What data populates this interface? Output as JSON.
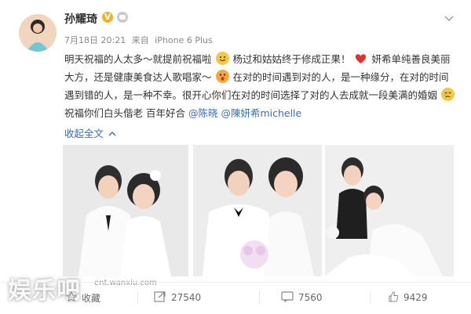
{
  "user": {
    "name": "孙耀琦",
    "verified_badge": "V"
  },
  "meta": {
    "time": "7月18日 20:21",
    "source_prefix": "来自",
    "source": "iPhone 6 Plus"
  },
  "post": {
    "seg1": "明天祝福的人太多～就提前祝福啦",
    "seg2": "杨过和姑姑终于修成正果！",
    "seg3": "妍希单纯善良美丽大方，还是健康美食达人歌唱家～",
    "seg4": "在对的时间遇到对的人，是一种缘分，在对的时间遇到错的人，是一种不幸。很开心你们在对的时间选择了对的人去成就一段美满的婚姻",
    "seg5": "祝福你们白头偕老 百年好合 ",
    "mention1": "@陈晓",
    "mention2": "@陳妍希michelle",
    "emoji_names": [
      "smile-emoji",
      "heart-emoji",
      "surprise-emoji",
      "cry-emoji"
    ]
  },
  "collapse_label": "收起全文",
  "actions": {
    "favorite_label": "收藏",
    "repost_count": "27540",
    "comment_count": "7560",
    "like_count": "9429"
  },
  "watermark": {
    "text": "娱乐吧",
    "sub": "ent.wanxiu.com"
  },
  "colors": {
    "link": "#3a6fb6",
    "badge": "#f4b02a"
  },
  "icons": [
    "chevron-down-icon",
    "star-icon",
    "repost-icon",
    "comment-icon",
    "thumbs-up-icon"
  ]
}
